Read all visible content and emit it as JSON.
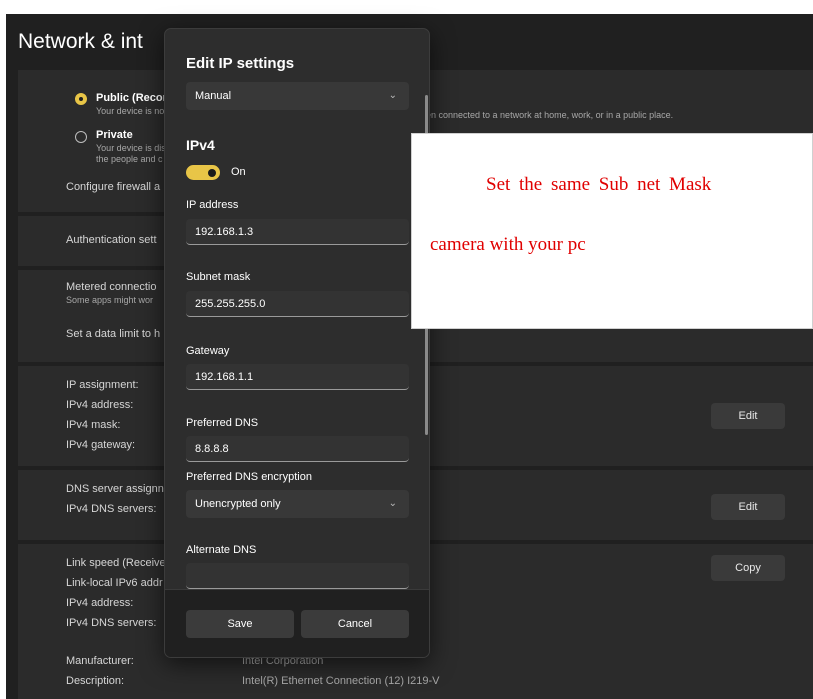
{
  "page": {
    "title": "Network & int"
  },
  "profile": {
    "public": {
      "label": "Public (Recom",
      "desc": "Your device is no",
      "desc_right": "en connected to a network at home, work, or in a public place."
    },
    "private": {
      "label": "Private",
      "desc1": "Your device is dis",
      "desc2": "the people and c"
    },
    "firewall_link": "Configure firewall a"
  },
  "auth": {
    "label": "Authentication sett"
  },
  "metered": {
    "label": "Metered connectio",
    "desc": "Some apps might wor",
    "data_limit": "Set a data limit to h"
  },
  "ip_props": {
    "rows": [
      "IP assignment:",
      "IPv4 address:",
      "IPv4 mask:",
      "IPv4 gateway:"
    ],
    "edit_label": "Edit"
  },
  "dns_props": {
    "rows": [
      "DNS server assignn",
      "IPv4 DNS servers:"
    ],
    "edit_label": "Edit"
  },
  "link_props": {
    "rows": [
      "Link speed (Receive",
      "Link-local IPv6 addr",
      "IPv4 address:",
      "IPv4 DNS servers:"
    ],
    "copy_label": "Copy",
    "manufacturer_label": "Manufacturer:",
    "manufacturer_value": "Intel Corporation",
    "description_label": "Description:",
    "description_value": "Intel(R) Ethernet Connection (12) I219-V"
  },
  "dialog": {
    "title": "Edit IP settings",
    "mode": "Manual",
    "section": "IPv4",
    "toggle_label": "On",
    "toggle_on": true,
    "ip_label": "IP address",
    "ip_value": "192.168.1.3",
    "mask_label": "Subnet mask",
    "mask_value": "255.255.255.0",
    "gateway_label": "Gateway",
    "gateway_value": "192.168.1.1",
    "pref_dns_label": "Preferred DNS",
    "pref_dns_value": "8.8.8.8",
    "dns_enc_label": "Preferred DNS encryption",
    "dns_enc_value": "Unencrypted only",
    "alt_dns_label": "Alternate DNS",
    "save_label": "Save",
    "cancel_label": "Cancel"
  },
  "annotation": {
    "line1": "Set the same Sub net Mask",
    "line2": "camera with your pc",
    "color": "#e00000"
  },
  "colors": {
    "accent": "#e8c547",
    "background": "#202020",
    "panel": "#2b2b2b"
  }
}
